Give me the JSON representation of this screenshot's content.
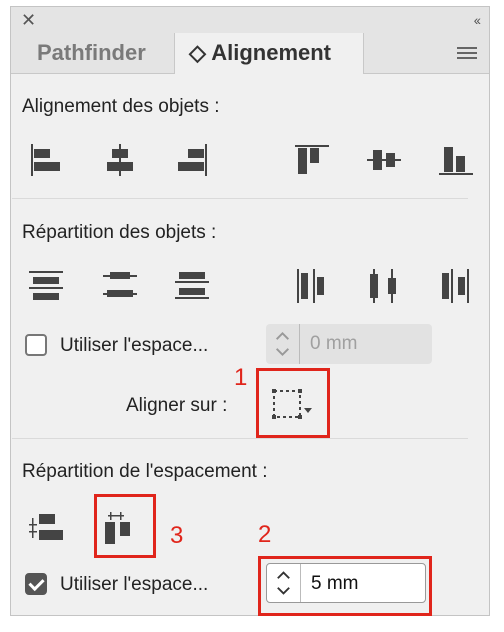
{
  "panel": {
    "tabs": [
      {
        "label": "Pathfinder",
        "active": false
      },
      {
        "label": "◇ Alignement",
        "active": true
      }
    ]
  },
  "sections": {
    "align_objects": {
      "title": "Alignement des objets :",
      "icons": [
        "align-left-icon",
        "align-horizontal-center-icon",
        "align-right-icon",
        "align-top-icon",
        "align-vertical-center-icon",
        "align-bottom-icon"
      ]
    },
    "distribute_objects": {
      "title": "Répartition des objets :",
      "icons": [
        "distribute-top-icon",
        "distribute-vertical-center-icon",
        "distribute-bottom-icon",
        "distribute-left-icon",
        "distribute-horizontal-center-icon",
        "distribute-right-icon"
      ],
      "use_spacing_label": "Utiliser l'espace...",
      "use_spacing_checked": false,
      "spacing_value": "0 mm",
      "align_to_label": "Aligner sur :"
    },
    "distribute_spacing": {
      "title": "Répartition de l'espacement :",
      "icons": [
        "distribute-horizontal-spacing-icon",
        "distribute-vertical-spacing-icon"
      ],
      "use_spacing_label": "Utiliser l'espace...",
      "use_spacing_checked": true,
      "spacing_value": "5 mm"
    }
  },
  "annotations": {
    "label_1": "1",
    "label_2": "2",
    "label_3": "3",
    "color": "#e0251b"
  }
}
